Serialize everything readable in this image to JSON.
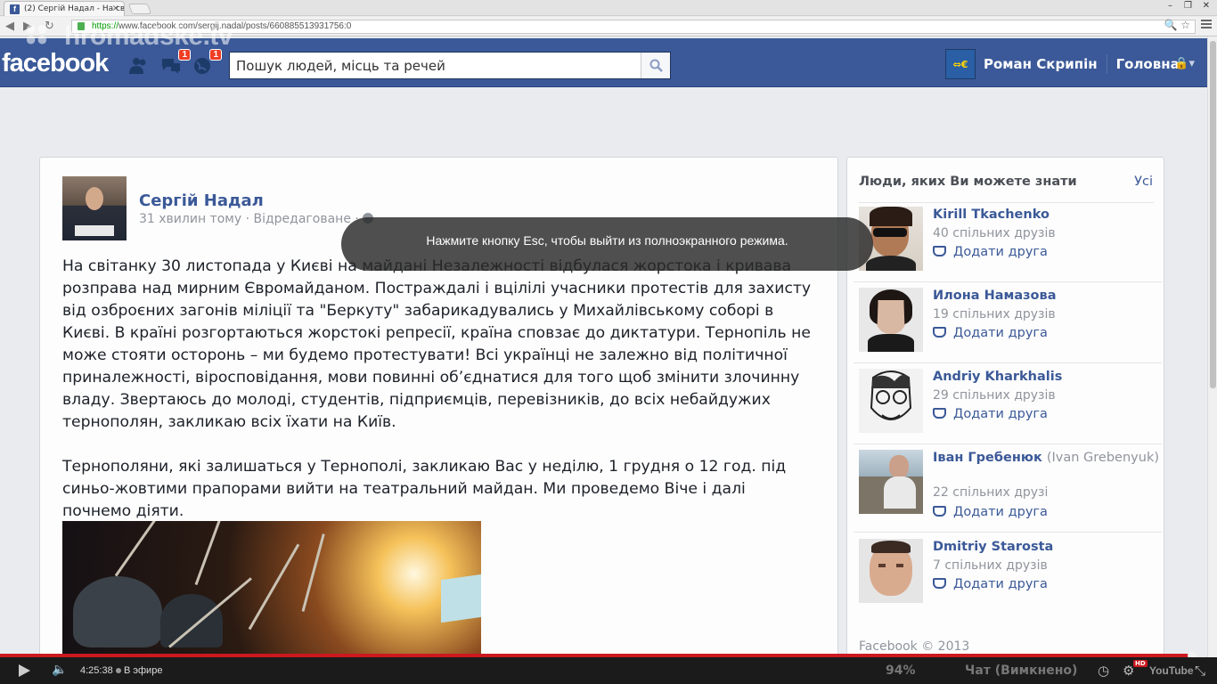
{
  "browser": {
    "tab_title": "(2) Сергій Надал - На сві",
    "url_https": "https://",
    "url_rest": "www.facebook.com/sergij.nadal/posts/660885513931756:0"
  },
  "watermark": "hromadske.tv",
  "facebook": {
    "logo": "facebook",
    "badges": {
      "messages": "1",
      "notifications": "1"
    },
    "search_placeholder": "Пошук людей, місць та речей",
    "user_name": "Роман Скрипін",
    "home_label": "Головна"
  },
  "post": {
    "author": "Сергій Надал",
    "time": "31 хвилин тому",
    "edited": "Відредаговане",
    "paragraphs": [
      "На світанку 30 листопада у Києві на майдані Незалежності відбулася жорстока і кривава розправа над мирним Євромайданом. Постраждалі і вцілілі учасники протестів для захисту від озброєних загонів міліції та \"Беркуту\" забарикадувались у Михайлівському соборі в Києві. В країні розгортаються жорстокі репресії, країна сповзає до диктатури. Тернопіль не може стояти осторонь – ми будемо протестувати! Всі українці не залежно від політичної приналежності, віросповідання, мови повинні об’єднатися для того щоб змінити злочинну владу. Звертаюсь до молоді, студентів, підприємців, перевізників, до всіх небайдужих тернополян, закликаю всіх їхати на Київ.",
      "Тернополяни, які залишаться у Тернополі, закликаю Вас у неділю, 1 грудня о 12 год. під синьо-жовтими прапорами вийти на театральний майдан. Ми проведемо Віче і далі почнемо діяти."
    ]
  },
  "sidebar": {
    "title": "Люди, яких Ви можете знати",
    "all_link": "Усі",
    "add_friend_label": "Додати друга",
    "people": [
      {
        "name": "Kirill Tkachenko",
        "alt": "",
        "mutual": "40 спільних друзів"
      },
      {
        "name": "Илона Намазова",
        "alt": "",
        "mutual": "19 спільних друзів"
      },
      {
        "name": "Andriy Kharkhalis",
        "alt": "",
        "mutual": "29 спільних друзів"
      },
      {
        "name": "Іван Гребенюк",
        "alt": "(Ivan Grebenyuk)",
        "mutual": "22 спільних друзі"
      },
      {
        "name": "Dmitriy Starosta",
        "alt": "",
        "mutual": "7 спільних друзів"
      }
    ],
    "footer": "Facebook © 2013"
  },
  "toast": "Нажмите кнопку Esc, чтобы выйти из полноэкранного режима.",
  "player": {
    "time": "4:25:38",
    "live_label": "В эфире",
    "hd": "HD",
    "logo": "YouTube",
    "chat_overlay_percent": "94%",
    "chat_overlay_label": "Чат (Вимкнено)"
  }
}
